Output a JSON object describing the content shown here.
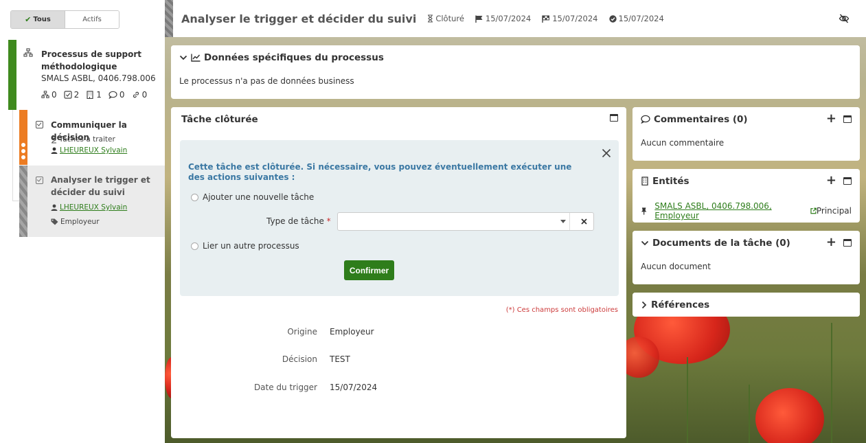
{
  "sidebar": {
    "filter": {
      "all": "Tous",
      "active": "Actifs"
    },
    "process": {
      "title": "Processus de support méthodologique",
      "subtitle": "SMALS ASBL, 0406.798.006",
      "counts": {
        "subprocesses": "0",
        "tasks": "2",
        "entities": "1",
        "comments": "0",
        "links": "0"
      }
    },
    "tasks": [
      {
        "title": "Communiquer la décision",
        "status": "Tâches à traiter",
        "assignee": "LHEUREUX Sylvain",
        "color": "#ec7c23"
      },
      {
        "title": "Analyser le trigger et décider du suivi",
        "assignee": "LHEUREUX Sylvain",
        "tag": "Employeur"
      }
    ]
  },
  "header": {
    "title": "Analyser le trigger et décider du suivi",
    "status": "Clôturé",
    "date_start": "15/07/2024",
    "date_end": "15/07/2024",
    "date_done": "15/07/2024"
  },
  "process_data": {
    "title": "Données spécifiques du processus",
    "body": "Le processus n'a pas de données business"
  },
  "task_panel": {
    "title": "Tâche clôturée",
    "alert_message": "Cette tâche est clôturée. Si nécessaire, vous pouvez éventuellement exécuter une des actions suivantes :",
    "option_new_task": "Ajouter une nouvelle tâche",
    "type_label": "Type de tâche",
    "required_mark": "*",
    "option_link_process": "Lier un autre processus",
    "confirm_label": "Confirmer",
    "required_note": "(*) Ces champs sont obligatoires",
    "fields": [
      {
        "label": "Origine",
        "value": "Employeur"
      },
      {
        "label": "Décision",
        "value": "TEST"
      },
      {
        "label": "Date du trigger",
        "value": "15/07/2024"
      }
    ]
  },
  "comments": {
    "title": "Commentaires (0)",
    "body": "Aucun commentaire"
  },
  "entities": {
    "title": "Entités",
    "link": "SMALS ASBL, 0406.798.006, Employeur",
    "role": "Principal"
  },
  "documents": {
    "title": "Documents de la tâche (0)",
    "body": "Aucun document"
  },
  "references": {
    "title": "Références"
  },
  "colors": {
    "accent_green": "#2e7d1b",
    "process_green": "#3f8a1e",
    "task_orange": "#ec7c23",
    "info_blue": "#3b78a3",
    "required_red": "#cc2a2a"
  }
}
